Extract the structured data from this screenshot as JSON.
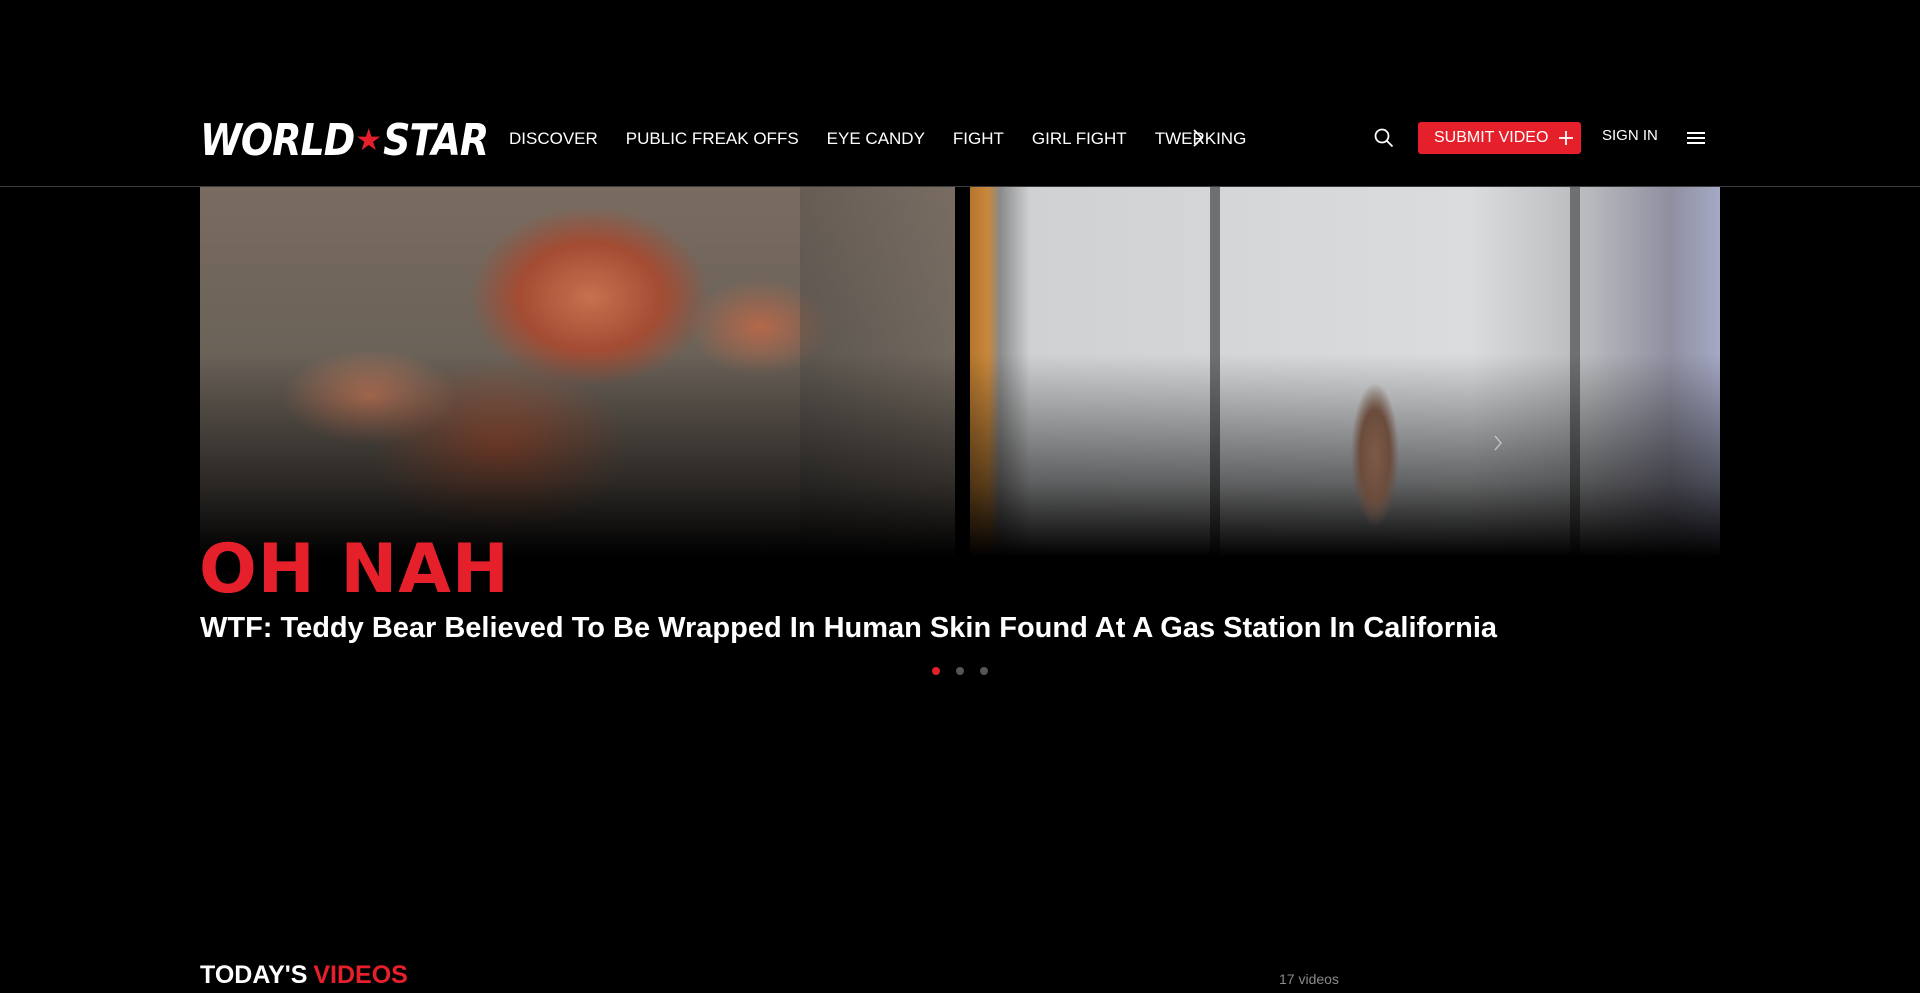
{
  "header": {
    "logo_text_left": "WORLD",
    "logo_text_right": "STAR",
    "nav": [
      {
        "label": "DISCOVER"
      },
      {
        "label": "PUBLIC FREAK OFFS"
      },
      {
        "label": "EYE CANDY"
      },
      {
        "label": "FIGHT"
      },
      {
        "label": "GIRL FIGHT"
      },
      {
        "label": "TWERKING"
      }
    ],
    "submit_label": "SUBMIT VIDEO",
    "signin_label": "SIGN IN",
    "accent_color": "#e5202a"
  },
  "hero": {
    "kicker": "OH NAH",
    "title": "WTF: Teddy Bear Believed To Be Wrapped In Human Skin Found At A Gas Station In California",
    "slides": 3,
    "active_slide": 1
  },
  "today": {
    "title_part1": "TODAY'S",
    "title_part2": "VIDEOS",
    "count": "17 videos"
  }
}
